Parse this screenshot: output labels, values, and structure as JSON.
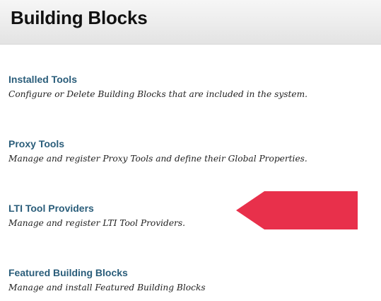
{
  "header": {
    "title": "Building Blocks"
  },
  "tools": [
    {
      "label": "Installed Tools",
      "description": "Configure or Delete Building Blocks that are included in the system."
    },
    {
      "label": "Proxy Tools",
      "description": "Manage and register Proxy Tools and define their Global Properties."
    },
    {
      "label": "LTI Tool Providers",
      "description": "Manage and register LTI Tool Providers."
    },
    {
      "label": "Featured Building Blocks",
      "description": "Manage and install Featured Building Blocks"
    }
  ],
  "colors": {
    "link": "#2a5d7a",
    "annotation_arrow": "#e8304b"
  }
}
